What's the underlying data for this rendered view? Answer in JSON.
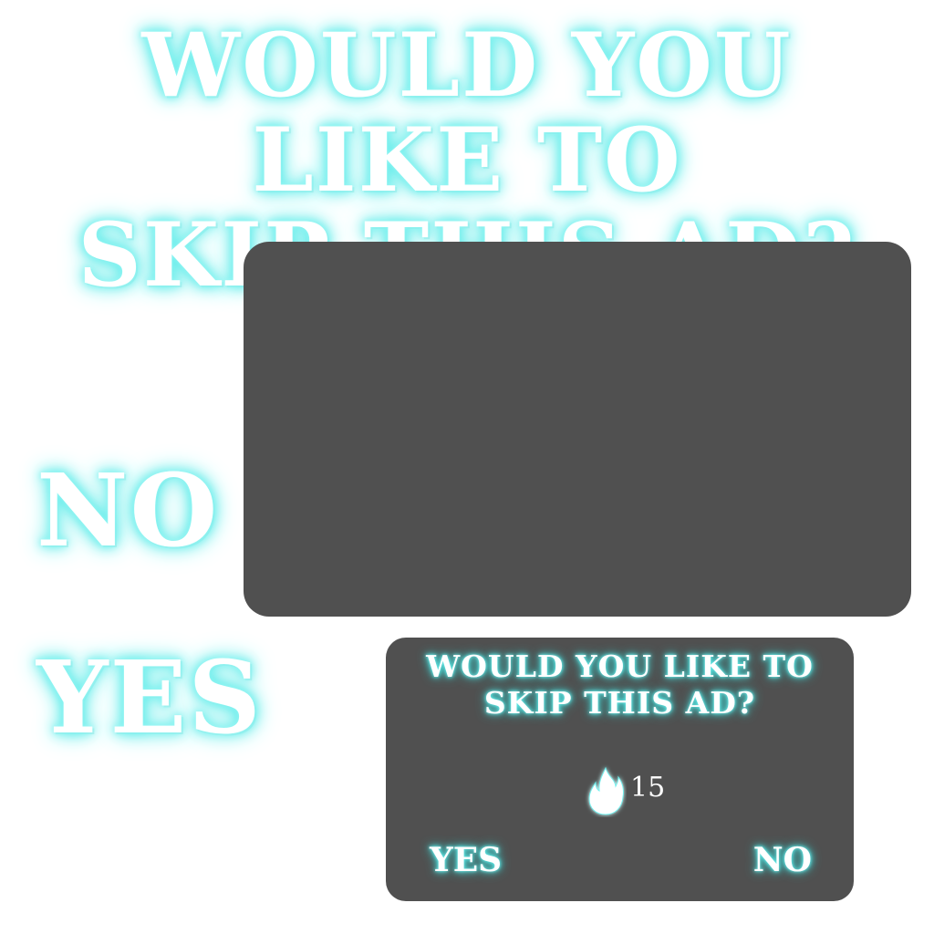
{
  "title": {
    "line1": "WOULD YOU LIKE TO",
    "line2": "SKIP THIS AD?"
  },
  "labels": {
    "no": "NO",
    "yes": "YES"
  },
  "dialog": {
    "title_line1": "WOULD YOU LIKE TO",
    "title_line2": "SKIP THIS AD?",
    "cost_icon": "flame-icon",
    "cost_value": "15",
    "yes_label": "YES",
    "no_label": "NO"
  },
  "colors": {
    "glow": "#55e8e6",
    "panel": "#505050",
    "text": "#ffffff",
    "background": "#ffffff"
  }
}
